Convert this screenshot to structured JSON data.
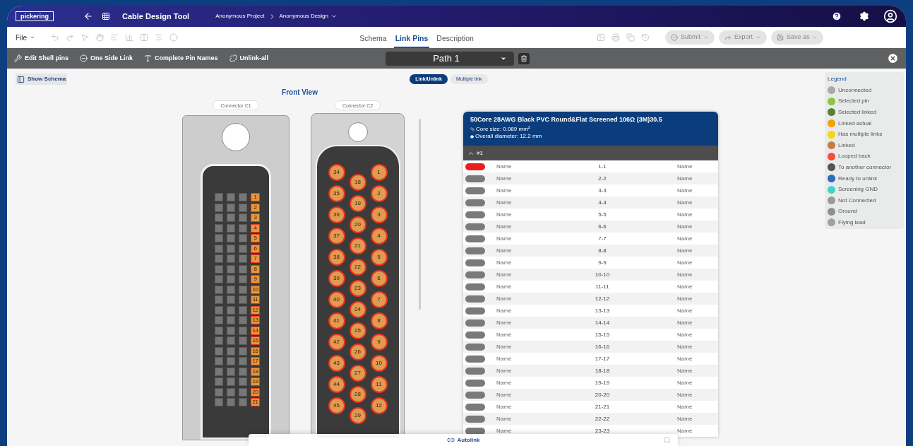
{
  "header": {
    "logo": "pickering",
    "title": "Cable Design Tool",
    "breadcrumbs": [
      "Anonymous Project",
      "Anonymous Design"
    ]
  },
  "toolbar": {
    "file_menu": "File",
    "tabs": [
      {
        "label": "Schema",
        "selected": false
      },
      {
        "label": "Link Pins",
        "selected": true
      },
      {
        "label": "Description",
        "selected": false
      }
    ],
    "buttons": [
      {
        "label": "Submit",
        "disabled": true
      },
      {
        "label": "Export",
        "disabled": true
      },
      {
        "label": "Save as",
        "disabled": true
      }
    ]
  },
  "action_bar": {
    "actions": [
      {
        "kind": "shell",
        "label": "Edit Shell pins"
      },
      {
        "kind": "oneside",
        "label": "One Side Link"
      },
      {
        "kind": "names",
        "label": "Complete Pin Names"
      },
      {
        "kind": "unlink",
        "label": "Unlink-all"
      }
    ],
    "path_select": "Path 1"
  },
  "content": {
    "show_schema": "Show Schema",
    "modes": [
      {
        "label": "Link/Unlink",
        "selected": true
      },
      {
        "label": "Multiple link",
        "selected": false
      }
    ],
    "view_title": "Front View",
    "connectors": [
      {
        "kind": "ribbon",
        "label": "Connector C1",
        "pins": [
          "1",
          "2",
          "3",
          "4",
          "5",
          "6",
          "7",
          "8",
          "9",
          "10",
          "11",
          "12",
          "13",
          "14",
          "15",
          "16",
          "17",
          "18",
          "19",
          "20",
          "21"
        ]
      },
      {
        "kind": "dsub",
        "label": "Connector C2",
        "columns": [
          [
            "34",
            "35",
            "36",
            "37",
            "38",
            "39",
            "40",
            "41",
            "42",
            "43",
            "44",
            "45"
          ],
          [
            "18",
            "19",
            "20",
            "21",
            "22",
            "23",
            "24",
            "25",
            "26",
            "27",
            "28",
            "29"
          ],
          [
            "1",
            "2",
            "3",
            "4",
            "5",
            "6",
            "7",
            "8",
            "9",
            "10",
            "11",
            "12"
          ]
        ]
      }
    ]
  },
  "cable": {
    "title": "50Core 28AWG Black PVC Round&Flat Screened 106Ω (3M)30.5",
    "core_size": "Core size: 0.089 mm$^{2}$",
    "diameter": "Overall diameter: 12.2 mm",
    "group": "#1",
    "rows": [
      {
        "color": "#ee1c1c",
        "left": "Name",
        "pair": "1-1",
        "right": "Name"
      },
      {
        "color": "#7a7a7a",
        "left": "Name",
        "pair": "2-2",
        "right": "Name"
      },
      {
        "color": "#7a7a7a",
        "left": "Name",
        "pair": "3-3",
        "right": "Name"
      },
      {
        "color": "#7a7a7a",
        "left": "Name",
        "pair": "4-4",
        "right": "Name"
      },
      {
        "color": "#7a7a7a",
        "left": "Name",
        "pair": "5-5",
        "right": "Name"
      },
      {
        "color": "#7a7a7a",
        "left": "Name",
        "pair": "6-6",
        "right": "Name"
      },
      {
        "color": "#7a7a7a",
        "left": "Name",
        "pair": "7-7",
        "right": "Name"
      },
      {
        "color": "#7a7a7a",
        "left": "Name",
        "pair": "8-8",
        "right": "Name"
      },
      {
        "color": "#7a7a7a",
        "left": "Name",
        "pair": "9-9",
        "right": "Name"
      },
      {
        "color": "#7a7a7a",
        "left": "Name",
        "pair": "10-10",
        "right": "Name"
      },
      {
        "color": "#7a7a7a",
        "left": "Name",
        "pair": "11-11",
        "right": "Name"
      },
      {
        "color": "#7a7a7a",
        "left": "Name",
        "pair": "12-12",
        "right": "Name"
      },
      {
        "color": "#7a7a7a",
        "left": "Name",
        "pair": "13-13",
        "right": "Name"
      },
      {
        "color": "#7a7a7a",
        "left": "Name",
        "pair": "14-14",
        "right": "Name"
      },
      {
        "color": "#7a7a7a",
        "left": "Name",
        "pair": "15-15",
        "right": "Name"
      },
      {
        "color": "#7a7a7a",
        "left": "Name",
        "pair": "16-16",
        "right": "Name"
      },
      {
        "color": "#7a7a7a",
        "left": "Name",
        "pair": "17-17",
        "right": "Name"
      },
      {
        "color": "#7a7a7a",
        "left": "Name",
        "pair": "18-18",
        "right": "Name"
      },
      {
        "color": "#7a7a7a",
        "left": "Name",
        "pair": "19-19",
        "right": "Name"
      },
      {
        "color": "#7a7a7a",
        "left": "Name",
        "pair": "20-20",
        "right": "Name"
      },
      {
        "color": "#7a7a7a",
        "left": "Name",
        "pair": "21-21",
        "right": "Name"
      },
      {
        "color": "#7a7a7a",
        "left": "Name",
        "pair": "22-22",
        "right": "Name"
      },
      {
        "color": "#7a7a7a",
        "left": "Name",
        "pair": "23-23",
        "right": "Name"
      }
    ]
  },
  "autolink": "Autolink",
  "legend": {
    "title": "Legend",
    "items": [
      {
        "label": "Unconnected",
        "color": "#a9a9a9"
      },
      {
        "label": "Selected pin",
        "color": "#8cc63f"
      },
      {
        "label": "Selected linked",
        "color": "#5b7f2b"
      },
      {
        "label": "Linked actual",
        "color": "#f5a100"
      },
      {
        "label": "Has multiple links",
        "color": "#f7d417"
      },
      {
        "label": "Linked",
        "color": "#c97c3d"
      },
      {
        "label": "Looped back",
        "color": "#f0513f"
      },
      {
        "label": "To another connector",
        "color": "#555555"
      },
      {
        "label": "Ready to unlink",
        "color": "#2f6db5"
      },
      {
        "label": "Screening GND",
        "color": "#3fd3cf"
      },
      {
        "label": "Not Connected",
        "color": "#9a9a9a"
      },
      {
        "label": "Ground",
        "color": "#8f8f8f"
      },
      {
        "label": "Flying lead",
        "color": "#a0a0a0"
      }
    ]
  }
}
